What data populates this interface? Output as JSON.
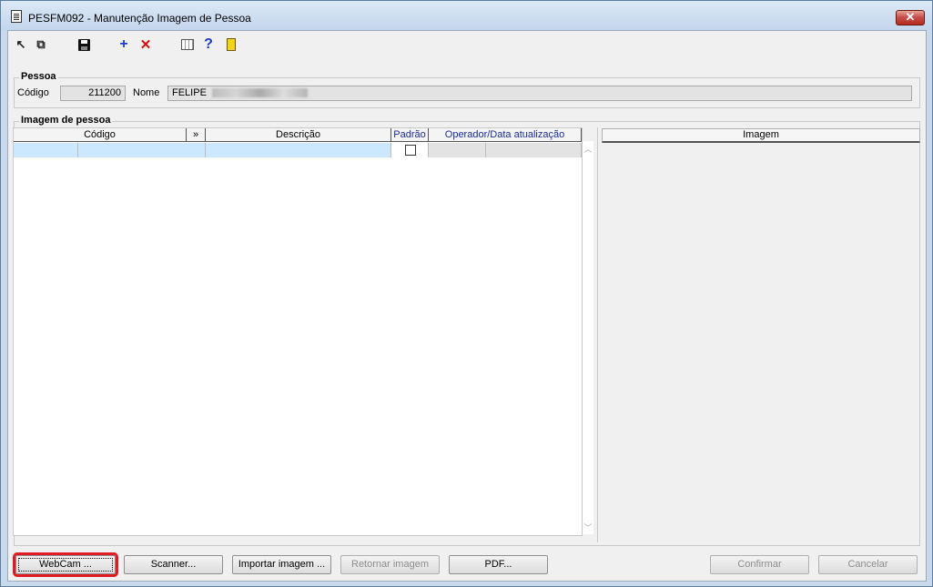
{
  "window": {
    "title": "PESFM092 - Manutenção Imagem de Pessoa",
    "close_label": "✕"
  },
  "toolbar": {
    "icons": [
      "arrow-icon",
      "copy-icon",
      "save-icon",
      "add-icon",
      "delete-icon",
      "calendar-icon",
      "help-icon",
      "exit-icon"
    ]
  },
  "pessoa": {
    "group_label": "Pessoa",
    "codigo_label": "Código",
    "codigo_value": "211200",
    "nome_label": "Nome",
    "nome_value": "FELIPE"
  },
  "imagem_pessoa": {
    "group_label": "Imagem de pessoa",
    "columns": [
      "Código",
      "»",
      "Descrição",
      "Padrão",
      "Operador/Data atualização"
    ],
    "image_header": "Imagem"
  },
  "buttons": {
    "webcam": "WebCam ...",
    "scanner": "Scanner...",
    "importar": "Importar imagem ...",
    "retornar": "Retornar imagem",
    "pdf": "PDF...",
    "confirmar": "Confirmar",
    "cancelar": "Cancelar"
  },
  "colors": {
    "selected_row": "#cce8ff",
    "focus_highlight": "#e01b24",
    "header_blue_text": "#1a2d9a"
  }
}
